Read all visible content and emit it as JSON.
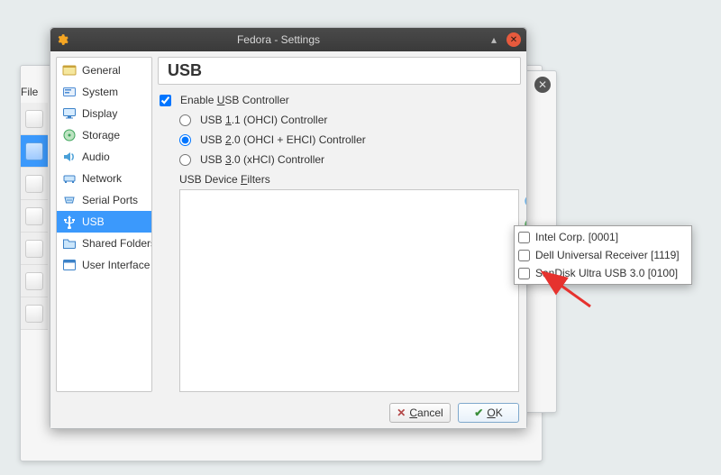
{
  "window": {
    "title": "Fedora - Settings"
  },
  "bg": {
    "file_menu": "File"
  },
  "sidebar": {
    "items": [
      {
        "label": "General"
      },
      {
        "label": "System"
      },
      {
        "label": "Display"
      },
      {
        "label": "Storage"
      },
      {
        "label": "Audio"
      },
      {
        "label": "Network"
      },
      {
        "label": "Serial Ports"
      },
      {
        "label": "USB"
      },
      {
        "label": "Shared Folders"
      },
      {
        "label": "User Interface"
      }
    ]
  },
  "content": {
    "heading": "USB",
    "enable_label_pre": "Enable ",
    "enable_label_u": "U",
    "enable_label_post": "SB Controller",
    "enable_checked": true,
    "radios": [
      {
        "pre": "USB ",
        "u": "1",
        "post": ".1 (OHCI) Controller",
        "checked": false
      },
      {
        "pre": "USB ",
        "u": "2",
        "post": ".0 (OHCI + EHCI) Controller",
        "checked": true
      },
      {
        "pre": "USB ",
        "u": "3",
        "post": ".0 (xHCI) Controller",
        "checked": false
      }
    ],
    "filters_legend_pre": "USB Device ",
    "filters_legend_u": "F",
    "filters_legend_post": "ilters"
  },
  "popup": {
    "items": [
      {
        "label": "Intel Corp.  [0001]"
      },
      {
        "label": "Dell Universal Receiver [1119]"
      },
      {
        "label": "SanDisk Ultra USB 3.0 [0100]"
      }
    ]
  },
  "buttons": {
    "cancel_u": "C",
    "cancel_rest": "ancel",
    "ok_u": "O",
    "ok_rest": "K"
  }
}
